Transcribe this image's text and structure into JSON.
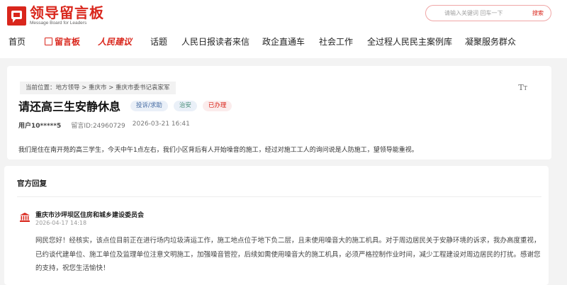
{
  "header": {
    "logo_cn": "领导留言板",
    "logo_en": "Message Board for Leaders",
    "search_placeholder": "请输入关键词 回车一下",
    "search_button": "搜索"
  },
  "nav": {
    "home": "首页",
    "message_board": "留言板",
    "rmrb_jianyi": "人民建议",
    "topics": "话题",
    "reader_letters": "人民日报读者来信",
    "gov_direct": "政企直通车",
    "social_work": "社会工作",
    "whole_process": "全过程人民民主案例库",
    "unite_service": "凝聚服务群众"
  },
  "message": {
    "breadcrumb": "当前位置：地方领导 > 重庆市 > 重庆市委书记袁家军",
    "font_toggle": "Tт",
    "title": "请还高三生安静休息",
    "tags": [
      "投诉/求助",
      "治安",
      "已办理"
    ],
    "user": "用户10*****5",
    "message_id": "留言ID:24960729",
    "datetime": "2026-03-21 16:41",
    "content": "我们是住在南开苑的高三学生，今天中午1点左右，我们小区背后有人开始噪音的施工，经过对施工工人的询问说是人防施工，望领导能重视。"
  },
  "reply": {
    "section_title": "官方回复",
    "department": "重庆市沙坪坝区住房和城乡建设委员会",
    "date": "2026-04-17 14:18",
    "text": "网民您好！经核实，该点位目前正在进行场内垃圾清运工作，施工地点位于地下负二层，且未使用噪音大的施工机具。对于周边居民关于安静环境的诉求，我办高度重视，已约谈代建单位、施工单位及监理单位注意文明施工，加强噪音管控，后续如需使用噪音大的施工机具，必须严格控制作业时间，减少工程建设对周边居民的打扰。感谢您的支持，祝您生活愉快！"
  },
  "colors": {
    "brand_red": "#d9261c",
    "tag_blue_text": "#4a6fa5",
    "tag_green_text": "#4a8f7a"
  }
}
